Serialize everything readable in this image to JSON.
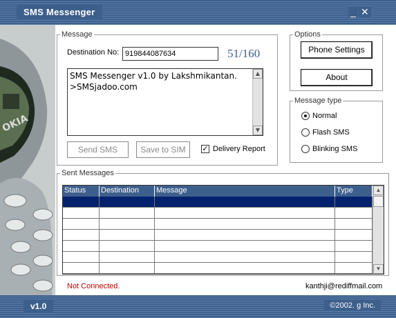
{
  "window": {
    "title": "SMS Messenger",
    "minimize_icon": "_",
    "close_icon": "✕",
    "version": "v1.0",
    "copyright": "©2002. g Inc."
  },
  "message": {
    "legend": "Message",
    "destination_label": "Destination No:",
    "destination_value": "919844087634",
    "counter": "51/160",
    "text_line1": "SMS Messenger v1.0 by Lakshmikantan.",
    "text_line2": ">SMSjadoo.com",
    "send_label": "Send SMS",
    "save_label": "Save to SIM",
    "delivery_label": "Delivery Report",
    "delivery_checked": true
  },
  "options": {
    "legend": "Options",
    "phone_settings_label": "Phone Settings",
    "about_label": "About"
  },
  "message_type": {
    "legend": "Message type",
    "options": [
      "Normal",
      "Flash SMS",
      "Blinking SMS"
    ],
    "selected": "Normal"
  },
  "sent": {
    "legend": "Sent Messages",
    "columns": [
      "Status",
      "Destination",
      "Message",
      "Type"
    ]
  },
  "status": {
    "connection": "Not Connected.",
    "email": "kanthji@rediffmail.com"
  },
  "colors": {
    "accent": "#3d5f8c",
    "selected_row": "#02226e",
    "error_text": "#c00000"
  }
}
